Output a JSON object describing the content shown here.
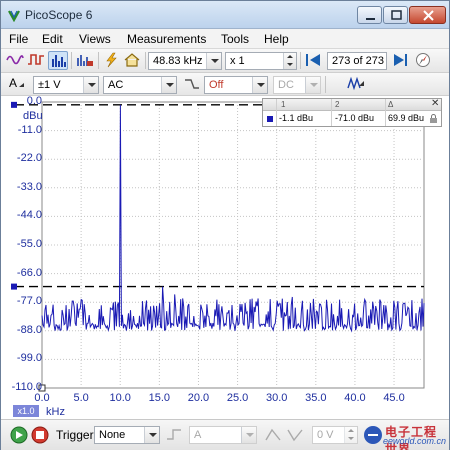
{
  "window": {
    "title": "PicoScope 6"
  },
  "menu": {
    "items": [
      "File",
      "Edit",
      "Views",
      "Measurements",
      "Tools",
      "Help"
    ]
  },
  "toolbar": {
    "icons": [
      "scope-mode-icon",
      "persistence-mode-icon",
      "spectrum-mode-icon",
      "spectrum-options-icon",
      "probe-icon",
      "home-icon"
    ],
    "active_mode": "spectrum-mode-icon",
    "frequency_range": "48.83 kHz",
    "zoom": "x 1",
    "buffer_position": "273 of 273"
  },
  "channel_bar": {
    "channel": "A",
    "range": "±1 V",
    "coupling": "AC",
    "filter": "Off",
    "dc_offset": "DC"
  },
  "measurements": {
    "columns": [
      "1",
      "2",
      "Δ"
    ],
    "row": {
      "marker": "1",
      "ruler1": "-1.1 dBu",
      "ruler2": "-71.0 dBu",
      "delta": "69.9 dBu"
    }
  },
  "status": {
    "trigger_label": "Trigger",
    "trigger_mode": "None",
    "trigger_channel": "A",
    "trigger_level": "0 V"
  },
  "watermark": {
    "main": "电子工程世界",
    "sub": "eeworld.com.cn"
  },
  "colors": {
    "trace": "#1a1ab4",
    "axis_text": "#1f2f9f",
    "ruler": "#000000"
  },
  "chart_data": {
    "type": "line",
    "ylabel": "dBu",
    "xunit": "kHz",
    "x_multiplier": "x1.0",
    "y_ticks": [
      "0.0",
      "-11.0",
      "-22.0",
      "-33.0",
      "-44.0",
      "-55.0",
      "-66.0",
      "-77.0",
      "-88.0",
      "-99.0",
      "-110.0"
    ],
    "x_ticks": [
      "0.0",
      "5.0",
      "10.0",
      "15.0",
      "20.0",
      "25.0",
      "30.0",
      "35.0",
      "40.0",
      "45.0"
    ],
    "ylim": [
      -110,
      0
    ],
    "xlim": [
      0,
      48.83
    ],
    "grid": true,
    "rulers": [
      -1.1,
      -71.0
    ],
    "series": [
      {
        "peaks": [
          {
            "x": 10.0,
            "y": -1.1
          },
          {
            "x": 15.4,
            "y": -71.0
          },
          {
            "x": 5.0,
            "y": -76.0
          },
          {
            "x": 17.0,
            "y": -74.0
          },
          {
            "x": 32.0,
            "y": -75.0
          },
          {
            "x": 38.0,
            "y": -76.0
          },
          {
            "x": 45.0,
            "y": -76.5
          }
        ],
        "noise_floor": -85.0,
        "noise_top": -76.5
      }
    ]
  }
}
